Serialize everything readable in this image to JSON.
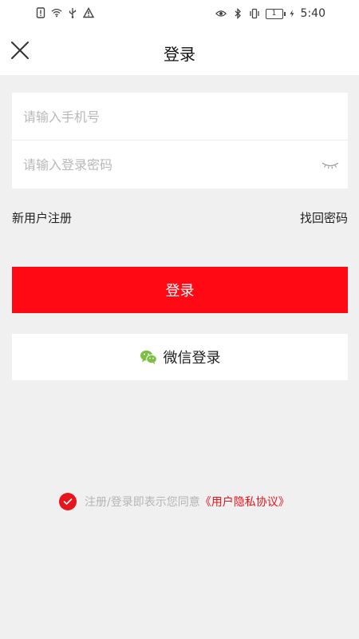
{
  "statusbar": {
    "sim": "1",
    "time": "5:40"
  },
  "header": {
    "title": "登录",
    "close_icon": "close-icon"
  },
  "form": {
    "phone_placeholder": "请输入手机号",
    "phone_value": "",
    "password_placeholder": "请输入登录密码",
    "password_value": "",
    "eye_icon": "eye-closed-icon"
  },
  "links": {
    "register": "新用户注册",
    "forgot": "找回密码"
  },
  "buttons": {
    "login": "登录",
    "wechat": "微信登录"
  },
  "agreement": {
    "checked": true,
    "text": "注册/登录即表示您同意",
    "link": "《用户隐私协议》"
  },
  "colors": {
    "accent": "#ff0a14",
    "agreement_red": "#e8151d",
    "wechat_green": "#7bc043",
    "background": "#f0f0f0"
  }
}
